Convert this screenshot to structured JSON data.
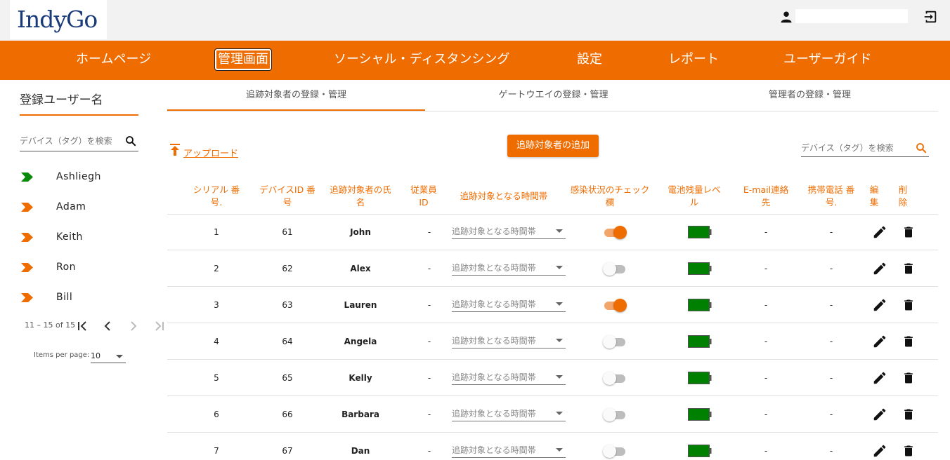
{
  "app": {
    "logo_text": "IndyGo"
  },
  "header": {
    "user_name": "",
    "user_icon": "person-icon",
    "logout_icon": "logout-icon"
  },
  "nav": [
    {
      "label": "ホームページ",
      "active": false
    },
    {
      "label": "管理画面",
      "active": true
    },
    {
      "label": "ソーシャル・ディスタンシング",
      "active": false
    },
    {
      "label": "設定",
      "active": false
    },
    {
      "label": "レポート",
      "active": false
    },
    {
      "label": "ユーザーガイド",
      "active": false
    }
  ],
  "sidebar": {
    "title": "登録ユーザー名",
    "search_placeholder": "デバイス（タグ）を検索",
    "users": [
      {
        "name": "Ashliegh",
        "arrow_color": "#0a8a0a"
      },
      {
        "name": "Adam",
        "arrow_color": "#ef6c00"
      },
      {
        "name": "Keith",
        "arrow_color": "#ef6c00"
      },
      {
        "name": "Ron",
        "arrow_color": "#ef6c00"
      },
      {
        "name": "Bill",
        "arrow_color": "#ef6c00"
      }
    ],
    "paginator": {
      "range": "11 – 15 of 15",
      "items_per_page_label": "Items per page:",
      "items_per_page": "10"
    }
  },
  "tabs": [
    {
      "label": "追跡対象者の登録・管理",
      "active": true
    },
    {
      "label": "ゲートウエイの登録・管理",
      "active": false
    },
    {
      "label": "管理者の登録・管理",
      "active": false
    }
  ],
  "toolbar": {
    "upload_label": "アップロード",
    "add_button": "追跡対象者の追加",
    "search_placeholder": "デバイス（タグ）を検索"
  },
  "table": {
    "headers": [
      [
        "シリアル 番",
        "号."
      ],
      [
        "デバイスID 番",
        "号"
      ],
      [
        "追跡対象者の氏",
        "名"
      ],
      [
        "従業員",
        "ID"
      ],
      [
        "追跡対象となる時間帯",
        ""
      ],
      [
        "感染状況のチェック",
        "欄"
      ],
      [
        "電池残量レベ",
        "ル"
      ],
      [
        "E-mail連絡",
        "先"
      ],
      [
        "携帯電話 番",
        "号."
      ],
      [
        "編",
        "集"
      ],
      [
        "削",
        "除"
      ]
    ],
    "time_placeholder": "追跡対象となる時間帯",
    "rows": [
      {
        "serial": "1",
        "device_id": "61",
        "name": "John",
        "employee_id": "-",
        "infected": true,
        "battery_level": 1.0,
        "email": "-",
        "phone": "-"
      },
      {
        "serial": "2",
        "device_id": "62",
        "name": "Alex",
        "employee_id": "-",
        "infected": false,
        "battery_level": 1.0,
        "email": "-",
        "phone": "-"
      },
      {
        "serial": "3",
        "device_id": "63",
        "name": "Lauren",
        "employee_id": "-",
        "infected": true,
        "battery_level": 1.0,
        "email": "-",
        "phone": "-"
      },
      {
        "serial": "4",
        "device_id": "64",
        "name": "Angela",
        "employee_id": "-",
        "infected": false,
        "battery_level": 1.0,
        "email": "-",
        "phone": "-"
      },
      {
        "serial": "5",
        "device_id": "65",
        "name": "Kelly",
        "employee_id": "-",
        "infected": false,
        "battery_level": 1.0,
        "email": "-",
        "phone": "-"
      },
      {
        "serial": "6",
        "device_id": "66",
        "name": "Barbara",
        "employee_id": "-",
        "infected": false,
        "battery_level": 1.0,
        "email": "-",
        "phone": "-"
      },
      {
        "serial": "7",
        "device_id": "67",
        "name": "Dan",
        "employee_id": "-",
        "infected": false,
        "battery_level": 1.0,
        "email": "-",
        "phone": "-"
      }
    ]
  },
  "colors": {
    "accent": "#ef6c00",
    "battery": "#008000",
    "toggle_on_track": "#f4a56a",
    "toggle_off_track": "#bdbdbd"
  }
}
